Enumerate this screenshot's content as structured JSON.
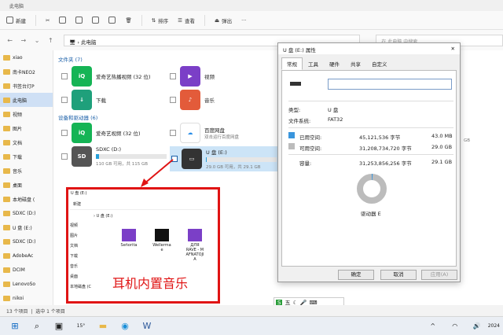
{
  "window": {
    "title": "此电脑"
  },
  "cmdbar": {
    "new": "新建",
    "sort": "排序",
    "view": "查看",
    "eject": "弹出",
    "more": "···"
  },
  "address": {
    "path": "此电脑",
    "search": "在 此电脑 中搜索"
  },
  "sidebar": {
    "items": [
      "xiao",
      "南卡NEO2",
      "书签台灯P",
      "此电脑",
      "视频",
      "图片",
      "文档",
      "下载",
      "音乐",
      "桌面",
      "本地磁盘 (",
      "SDXC (D:)",
      "U 盘 (E:)",
      "SDXC (D:)",
      "AdobeAc",
      "DCIM",
      "LenovoSo",
      "nikoi"
    ]
  },
  "main": {
    "folders_header": "文件夹 (7)",
    "folders": [
      "爱奇艺热播视频 (32 位)",
      "视频",
      "下载",
      "音乐"
    ],
    "devices_header": "设备和驱动器 (6)",
    "devices": [
      {
        "name": "爱奇艺视频 (32 位)"
      },
      {
        "name": "百度网盘",
        "sub": "双击运行百度网盘"
      },
      {
        "name": "SDXC (D:)",
        "sub": "110 GB 可用，共 115 GB"
      },
      {
        "name": "U 盘 (E:)",
        "sub": "29.0 GB 可用，共 29.1 GB"
      }
    ],
    "partial_text": "GB"
  },
  "status": {
    "count": "13 个项目",
    "selected": "选中 1 个项目"
  },
  "dialog": {
    "title": "U 盘 (E:) 属性",
    "tabs": [
      "常规",
      "工具",
      "硬件",
      "共享",
      "自定义"
    ],
    "type_label": "类型:",
    "type_value": "U 盘",
    "fs_label": "文件系统:",
    "fs_value": "FAT32",
    "used_label": "已用空间:",
    "used_bytes": "45,121,536 字节",
    "used_size": "43.0 MB",
    "free_label": "可用空间:",
    "free_bytes": "31,208,734,720 字节",
    "free_size": "29.0 GB",
    "cap_label": "容量:",
    "cap_bytes": "31,253,856,256 字节",
    "cap_size": "29.1 GB",
    "drive_label": "驱动器 E",
    "ok": "确定",
    "cancel": "取消",
    "apply": "应用(A)",
    "used_color": "#3a96dd",
    "free_color": "#bcbcbc",
    "used_fraction": 0.0014
  },
  "overlay": {
    "path": "U 盘 (E:)",
    "new": "新建",
    "sidebar": [
      "视频",
      "图片",
      "文档",
      "下载",
      "音乐",
      "桌面",
      "本地磁盘 (C"
    ],
    "files": [
      "Señorita",
      "Wellerma\ne",
      "ДЛЯ\nRAVE - M\nAFNATOJI\nA"
    ],
    "caption": "耳机内置音乐",
    "accent": "#e01414"
  },
  "ime": {
    "text": "五"
  },
  "taskbar": {
    "weather": "15°",
    "time": "2024"
  }
}
